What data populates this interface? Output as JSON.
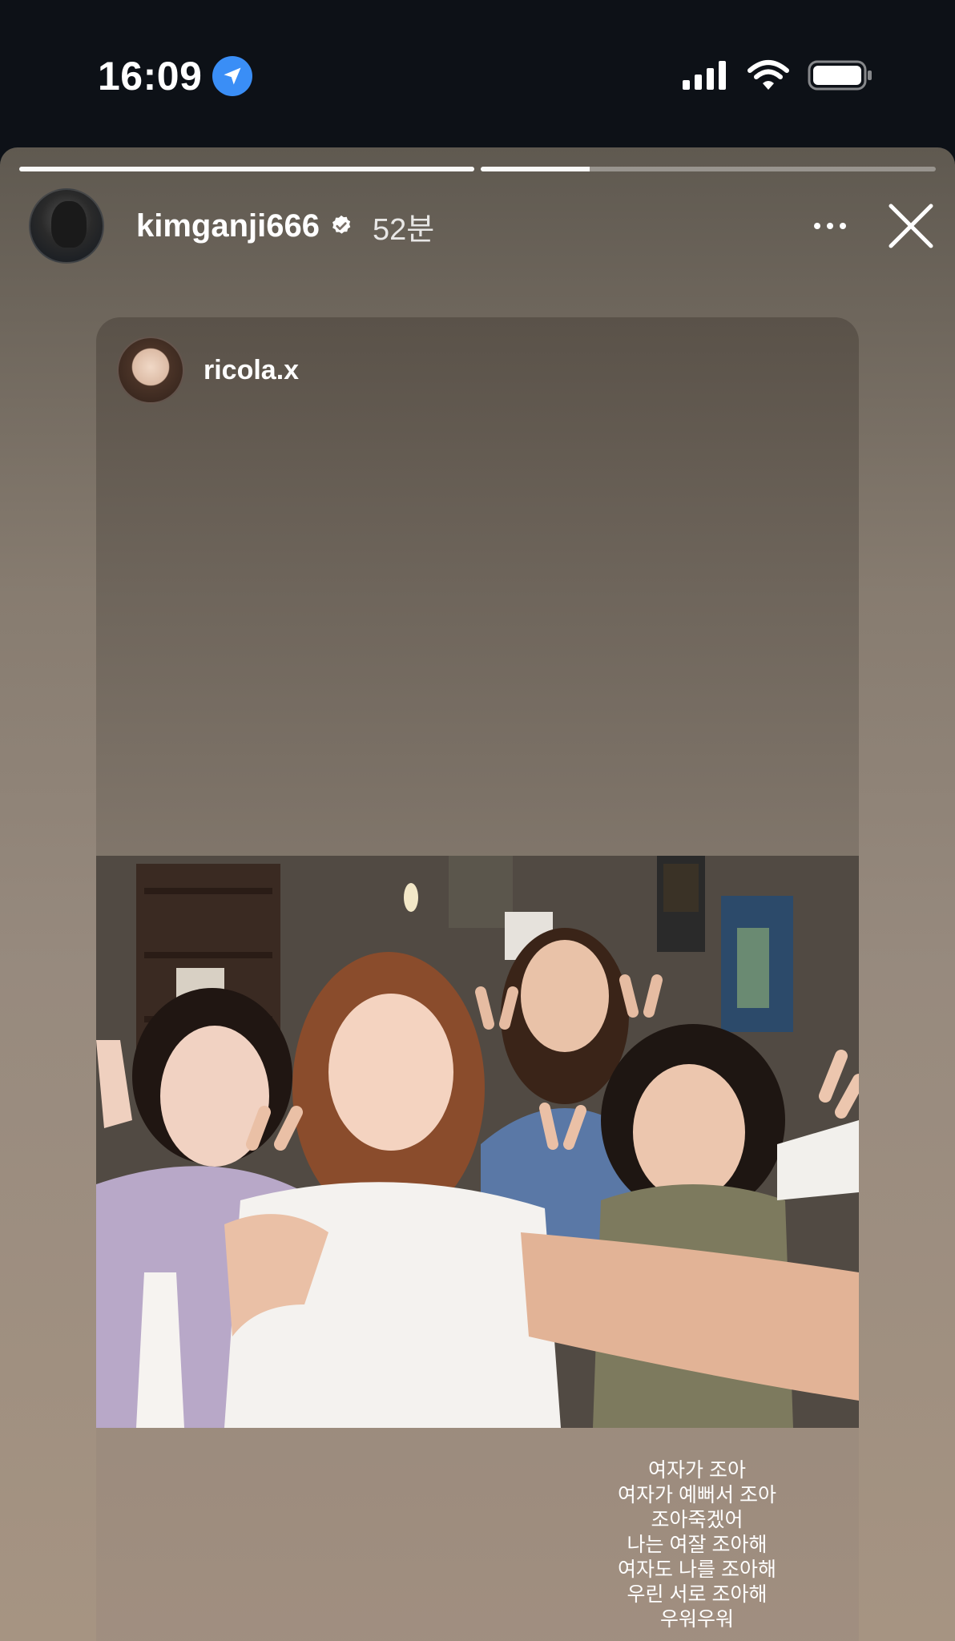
{
  "status_bar": {
    "time": "16:09",
    "icons": [
      "location-arrow-icon",
      "cellular-signal-icon",
      "wifi-icon",
      "battery-icon"
    ]
  },
  "story": {
    "progress": [
      1.0,
      0.24
    ],
    "username": "kimganji666",
    "verified": true,
    "time_ago": "52분",
    "icons": [
      "more-icon",
      "close-icon"
    ]
  },
  "shared_post": {
    "username": "ricola.x",
    "caption_lines": [
      "여자가 조아",
      "여자가 예뻐서 조아",
      "조아죽겠어",
      "나는 여잘 조아해",
      "여자도 나를 조아해",
      "우린 서로 조아해",
      "우워우워"
    ]
  },
  "colors": {
    "status_bg": "#0d1117",
    "location_badge": "#3a8ef6"
  }
}
